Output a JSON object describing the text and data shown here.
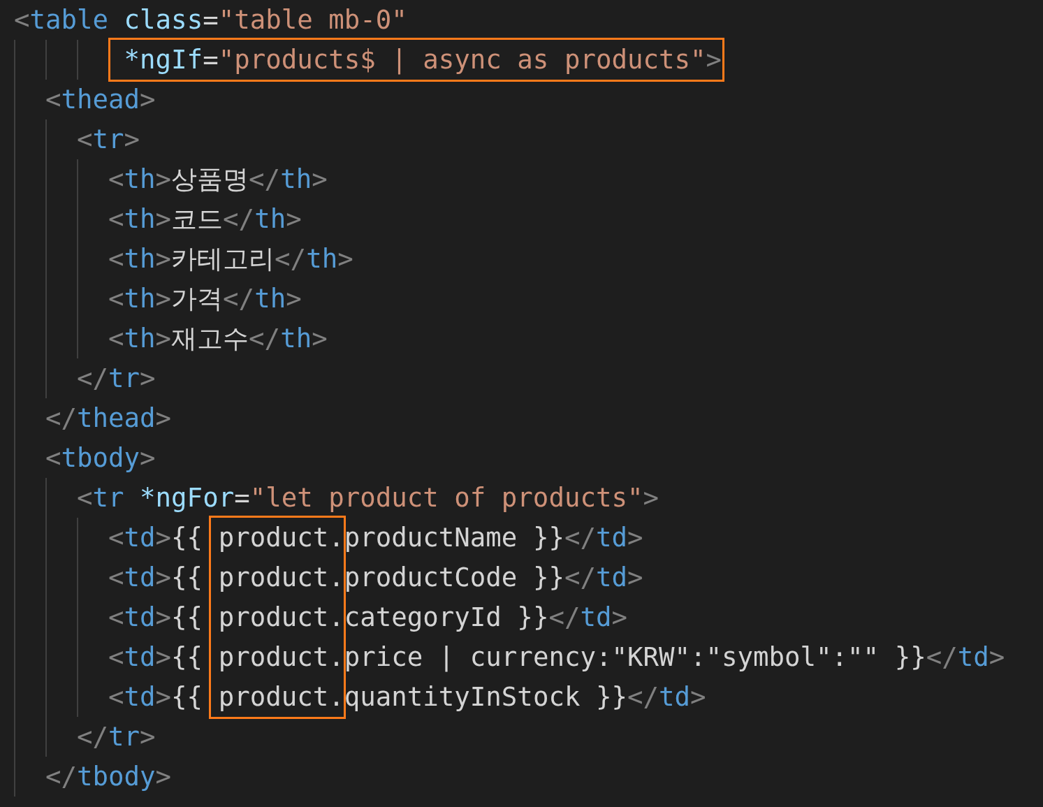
{
  "editor": {
    "lines": [
      {
        "tokens": [
          {
            "kind": "punct",
            "text": "<"
          },
          {
            "kind": "tag",
            "text": "table"
          },
          {
            "kind": "attr",
            "text": " class"
          },
          {
            "kind": "text",
            "text": "="
          },
          {
            "kind": "string",
            "text": "\"table mb-0\""
          }
        ],
        "children": [
          {
            "kind": "continuation",
            "tokens": [
              {
                "kind": "attr",
                "text": "*ngIf",
                "boxed": true
              },
              {
                "kind": "text",
                "text": "=",
                "boxed": true
              },
              {
                "kind": "string",
                "text": "\"products$ | async as products\"",
                "boxed": true
              },
              {
                "kind": "punct",
                "text": ">",
                "boxed": true
              }
            ]
          },
          {
            "tokens": [
              {
                "kind": "punct",
                "text": "<"
              },
              {
                "kind": "tag",
                "text": "thead"
              },
              {
                "kind": "punct",
                "text": ">"
              }
            ],
            "children": [
              {
                "tokens": [
                  {
                    "kind": "punct",
                    "text": "<"
                  },
                  {
                    "kind": "tag",
                    "text": "tr"
                  },
                  {
                    "kind": "punct",
                    "text": ">"
                  }
                ],
                "children": [
                  {
                    "tokens": [
                      {
                        "kind": "punct",
                        "text": "<"
                      },
                      {
                        "kind": "tag",
                        "text": "th"
                      },
                      {
                        "kind": "punct",
                        "text": ">"
                      },
                      {
                        "kind": "text",
                        "text": "상품명"
                      },
                      {
                        "kind": "punct",
                        "text": "</"
                      },
                      {
                        "kind": "tag",
                        "text": "th"
                      },
                      {
                        "kind": "punct",
                        "text": ">"
                      }
                    ]
                  },
                  {
                    "tokens": [
                      {
                        "kind": "punct",
                        "text": "<"
                      },
                      {
                        "kind": "tag",
                        "text": "th"
                      },
                      {
                        "kind": "punct",
                        "text": ">"
                      },
                      {
                        "kind": "text",
                        "text": "코드"
                      },
                      {
                        "kind": "punct",
                        "text": "</"
                      },
                      {
                        "kind": "tag",
                        "text": "th"
                      },
                      {
                        "kind": "punct",
                        "text": ">"
                      }
                    ]
                  },
                  {
                    "tokens": [
                      {
                        "kind": "punct",
                        "text": "<"
                      },
                      {
                        "kind": "tag",
                        "text": "th"
                      },
                      {
                        "kind": "punct",
                        "text": ">"
                      },
                      {
                        "kind": "text",
                        "text": "카테고리"
                      },
                      {
                        "kind": "punct",
                        "text": "</"
                      },
                      {
                        "kind": "tag",
                        "text": "th"
                      },
                      {
                        "kind": "punct",
                        "text": ">"
                      }
                    ]
                  },
                  {
                    "tokens": [
                      {
                        "kind": "punct",
                        "text": "<"
                      },
                      {
                        "kind": "tag",
                        "text": "th"
                      },
                      {
                        "kind": "punct",
                        "text": ">"
                      },
                      {
                        "kind": "text",
                        "text": "가격"
                      },
                      {
                        "kind": "punct",
                        "text": "</"
                      },
                      {
                        "kind": "tag",
                        "text": "th"
                      },
                      {
                        "kind": "punct",
                        "text": ">"
                      }
                    ]
                  },
                  {
                    "tokens": [
                      {
                        "kind": "punct",
                        "text": "<"
                      },
                      {
                        "kind": "tag",
                        "text": "th"
                      },
                      {
                        "kind": "punct",
                        "text": ">"
                      },
                      {
                        "kind": "text",
                        "text": "재고수"
                      },
                      {
                        "kind": "punct",
                        "text": "</"
                      },
                      {
                        "kind": "tag",
                        "text": "th"
                      },
                      {
                        "kind": "punct",
                        "text": ">"
                      }
                    ]
                  }
                ]
              },
              {
                "tokens": [
                  {
                    "kind": "punct",
                    "text": "</"
                  },
                  {
                    "kind": "tag",
                    "text": "tr"
                  },
                  {
                    "kind": "punct",
                    "text": ">"
                  }
                ]
              }
            ]
          },
          {
            "tokens": [
              {
                "kind": "punct",
                "text": "</"
              },
              {
                "kind": "tag",
                "text": "thead"
              },
              {
                "kind": "punct",
                "text": ">"
              }
            ]
          },
          {
            "tokens": [
              {
                "kind": "punct",
                "text": "<"
              },
              {
                "kind": "tag",
                "text": "tbody"
              },
              {
                "kind": "punct",
                "text": ">"
              }
            ],
            "children": [
              {
                "tokens": [
                  {
                    "kind": "punct",
                    "text": "<"
                  },
                  {
                    "kind": "tag",
                    "text": "tr"
                  },
                  {
                    "kind": "attr",
                    "text": " *ngFor"
                  },
                  {
                    "kind": "text",
                    "text": "="
                  },
                  {
                    "kind": "string",
                    "text": "\"let product of products\""
                  },
                  {
                    "kind": "punct",
                    "text": ">"
                  }
                ],
                "children": [
                  {
                    "tokens": [
                      {
                        "kind": "punct",
                        "text": "<"
                      },
                      {
                        "kind": "tag",
                        "text": "td"
                      },
                      {
                        "kind": "punct",
                        "text": ">"
                      },
                      {
                        "kind": "text",
                        "text": "{{ "
                      },
                      {
                        "kind": "text",
                        "text": "product.",
                        "boxed": true
                      },
                      {
                        "kind": "text",
                        "text": "productName }}"
                      },
                      {
                        "kind": "punct",
                        "text": "</"
                      },
                      {
                        "kind": "tag",
                        "text": "td"
                      },
                      {
                        "kind": "punct",
                        "text": ">"
                      }
                    ]
                  },
                  {
                    "tokens": [
                      {
                        "kind": "punct",
                        "text": "<"
                      },
                      {
                        "kind": "tag",
                        "text": "td"
                      },
                      {
                        "kind": "punct",
                        "text": ">"
                      },
                      {
                        "kind": "text",
                        "text": "{{ "
                      },
                      {
                        "kind": "text",
                        "text": "product.",
                        "boxed": true
                      },
                      {
                        "kind": "text",
                        "text": "productCode }}"
                      },
                      {
                        "kind": "punct",
                        "text": "</"
                      },
                      {
                        "kind": "tag",
                        "text": "td"
                      },
                      {
                        "kind": "punct",
                        "text": ">"
                      }
                    ]
                  },
                  {
                    "tokens": [
                      {
                        "kind": "punct",
                        "text": "<"
                      },
                      {
                        "kind": "tag",
                        "text": "td"
                      },
                      {
                        "kind": "punct",
                        "text": ">"
                      },
                      {
                        "kind": "text",
                        "text": "{{ "
                      },
                      {
                        "kind": "text",
                        "text": "product.",
                        "boxed": true
                      },
                      {
                        "kind": "text",
                        "text": "categoryId }}"
                      },
                      {
                        "kind": "punct",
                        "text": "</"
                      },
                      {
                        "kind": "tag",
                        "text": "td"
                      },
                      {
                        "kind": "punct",
                        "text": ">"
                      }
                    ]
                  },
                  {
                    "tokens": [
                      {
                        "kind": "punct",
                        "text": "<"
                      },
                      {
                        "kind": "tag",
                        "text": "td"
                      },
                      {
                        "kind": "punct",
                        "text": ">"
                      },
                      {
                        "kind": "text",
                        "text": "{{ "
                      },
                      {
                        "kind": "text",
                        "text": "product.",
                        "boxed": true
                      },
                      {
                        "kind": "text",
                        "text": "price | currency:\"KRW\":\"symbol\":\"\" }}"
                      },
                      {
                        "kind": "punct",
                        "text": "</"
                      },
                      {
                        "kind": "tag",
                        "text": "td"
                      },
                      {
                        "kind": "punct",
                        "text": ">"
                      }
                    ]
                  },
                  {
                    "tokens": [
                      {
                        "kind": "punct",
                        "text": "<"
                      },
                      {
                        "kind": "tag",
                        "text": "td"
                      },
                      {
                        "kind": "punct",
                        "text": ">"
                      },
                      {
                        "kind": "text",
                        "text": "{{ "
                      },
                      {
                        "kind": "text",
                        "text": "product.",
                        "boxed": true
                      },
                      {
                        "kind": "text",
                        "text": "quantityInStock }}"
                      },
                      {
                        "kind": "punct",
                        "text": "</"
                      },
                      {
                        "kind": "tag",
                        "text": "td"
                      },
                      {
                        "kind": "punct",
                        "text": ">"
                      }
                    ]
                  }
                ]
              },
              {
                "tokens": [
                  {
                    "kind": "punct",
                    "text": "</"
                  },
                  {
                    "kind": "tag",
                    "text": "tr"
                  },
                  {
                    "kind": "punct",
                    "text": ">"
                  }
                ]
              }
            ]
          },
          {
            "tokens": [
              {
                "kind": "punct",
                "text": "</"
              },
              {
                "kind": "tag",
                "text": "tbody"
              },
              {
                "kind": "punct",
                "text": ">"
              }
            ]
          }
        ]
      }
    ]
  }
}
